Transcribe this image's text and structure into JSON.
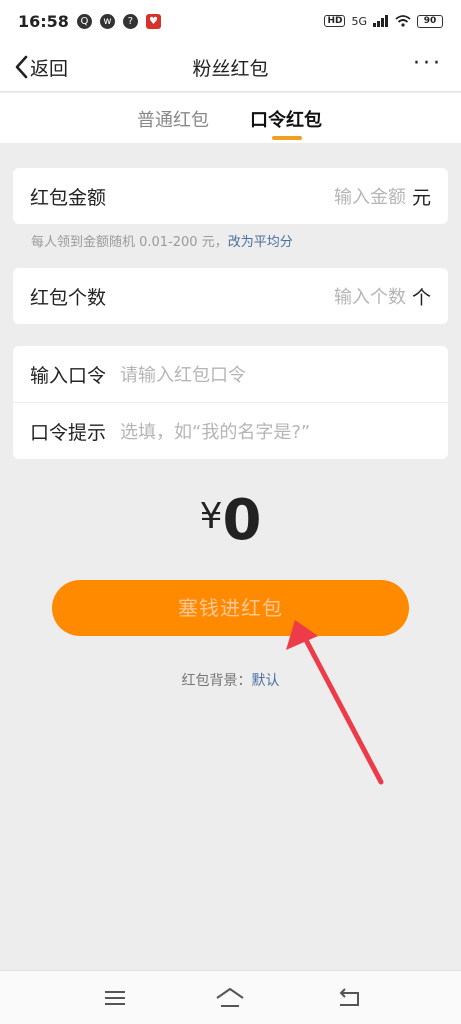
{
  "status_bar": {
    "time": "16:58",
    "network": "5G",
    "hd": "HD",
    "battery": "90"
  },
  "nav": {
    "back_label": "返回",
    "title": "粉丝红包",
    "more_label": "···"
  },
  "tabs": [
    {
      "label": "普通红包",
      "active": false
    },
    {
      "label": "口令红包",
      "active": true
    }
  ],
  "amount_card": {
    "label": "红包金额",
    "placeholder": "输入金额",
    "unit": "元"
  },
  "hint": {
    "text": "每人领到金额随机 0.01-200 元，",
    "link": "改为平均分"
  },
  "count_card": {
    "label": "红包个数",
    "placeholder": "输入个数",
    "unit": "个"
  },
  "command_card": {
    "command_label": "输入口令",
    "command_placeholder": "请输入红包口令",
    "tip_label": "口令提示",
    "tip_placeholder": "选填，如“我的名字是?”"
  },
  "total": {
    "symbol": "¥",
    "value": "0"
  },
  "submit_button": {
    "label": "塞钱进红包"
  },
  "background": {
    "label": "红包背景：",
    "value": "默认"
  },
  "colors": {
    "accent": "#ff8a00",
    "link": "#4a6fa0",
    "annotation_arrow": "#ee3b4a"
  },
  "icons": [
    "qq-icon",
    "weibo-icon",
    "help-icon",
    "app-icon",
    "signal-icon",
    "wifi-icon",
    "battery-icon",
    "back-chevron-icon",
    "more-icon",
    "menu-icon",
    "home-icon",
    "return-icon"
  ]
}
